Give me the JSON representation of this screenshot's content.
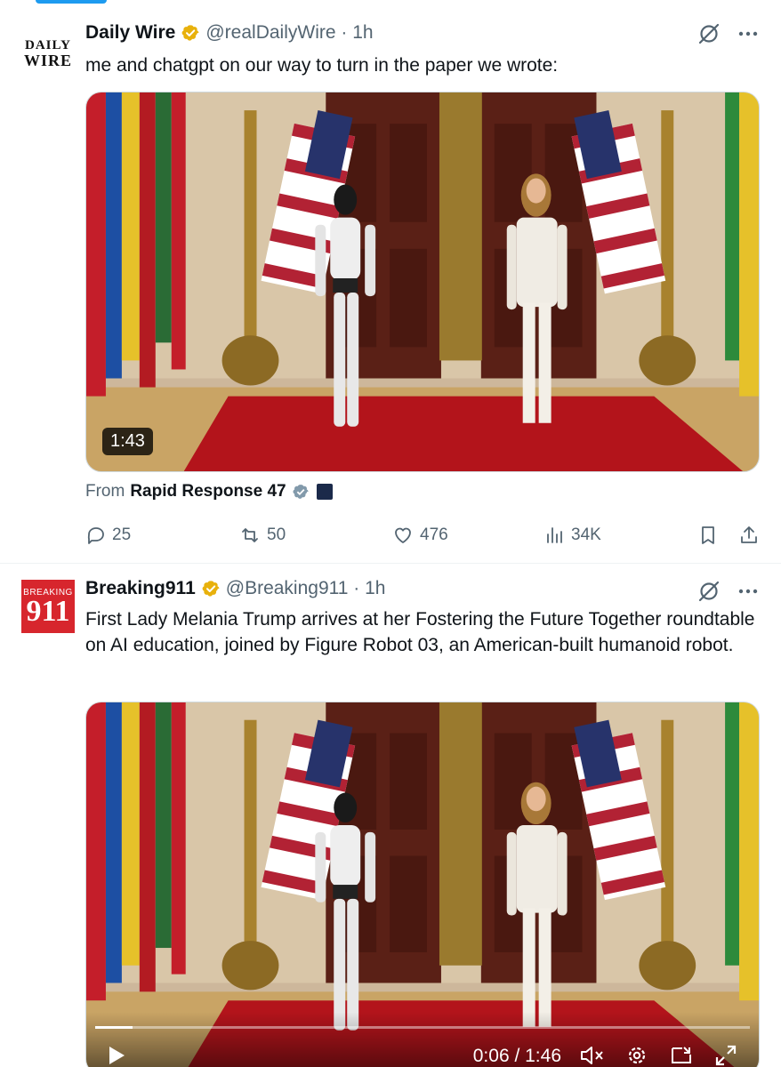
{
  "tweets": [
    {
      "avatar": {
        "line1": "DAILY",
        "line2": "WIRE"
      },
      "name": "Daily Wire",
      "handle": "@realDailyWire · 1h",
      "text": "me and chatgpt on our way to turn in the paper we wrote:",
      "video": {
        "duration": "1:43"
      },
      "from_label": "From",
      "from_name": "Rapid Response 47",
      "actions": {
        "replies": "25",
        "reposts": "50",
        "likes": "476",
        "views": "34K"
      }
    },
    {
      "avatar": {
        "line1": "BREAKING",
        "line2": "911"
      },
      "name": "Breaking911",
      "handle": "@Breaking911 · 1h",
      "text": "First Lady Melania Trump arrives at her Fostering the Future Together roundtable on AI education, joined by Figure Robot 03, an American-built humanoid robot.",
      "video": {
        "time": "0:06 / 1:46",
        "progress": 0.057
      }
    }
  ],
  "colors": {
    "accent": "#1d9bf0",
    "verified": "#e8b10c",
    "muted": "#536471",
    "carpet": "#b3141b"
  },
  "icons": [
    "verified-badge-icon",
    "grok-icon",
    "more-icon",
    "reply-icon",
    "repost-icon",
    "like-icon",
    "views-icon",
    "bookmark-icon",
    "share-icon",
    "play-icon",
    "mute-icon",
    "settings-icon",
    "pip-icon",
    "fullscreen-icon"
  ]
}
